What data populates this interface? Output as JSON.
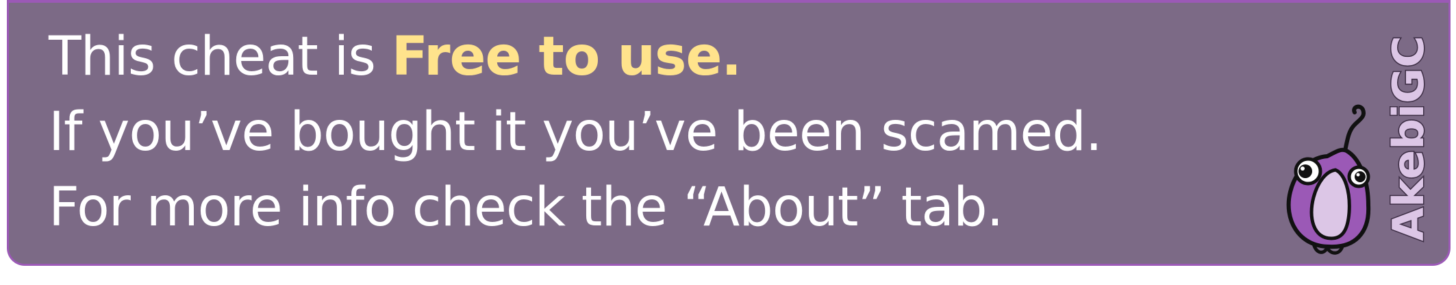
{
  "notice": {
    "line1_prefix": "This cheat is ",
    "line1_highlight": "Free to use.",
    "line2": "If you’ve bought it you’ve been scamed.",
    "line3": "For more info check the  “About”  tab."
  },
  "brand": {
    "name": "AkebiGC"
  },
  "colors": {
    "background": "#7c6a86",
    "border": "#9b59b6",
    "text": "#ffffff",
    "highlight": "#ffe38c",
    "mascot_dark": "#9b59b6",
    "mascot_light": "#dcc6e6",
    "brand_text": "#dcc6e6"
  },
  "icons": [
    "akebi-mascot-icon"
  ]
}
